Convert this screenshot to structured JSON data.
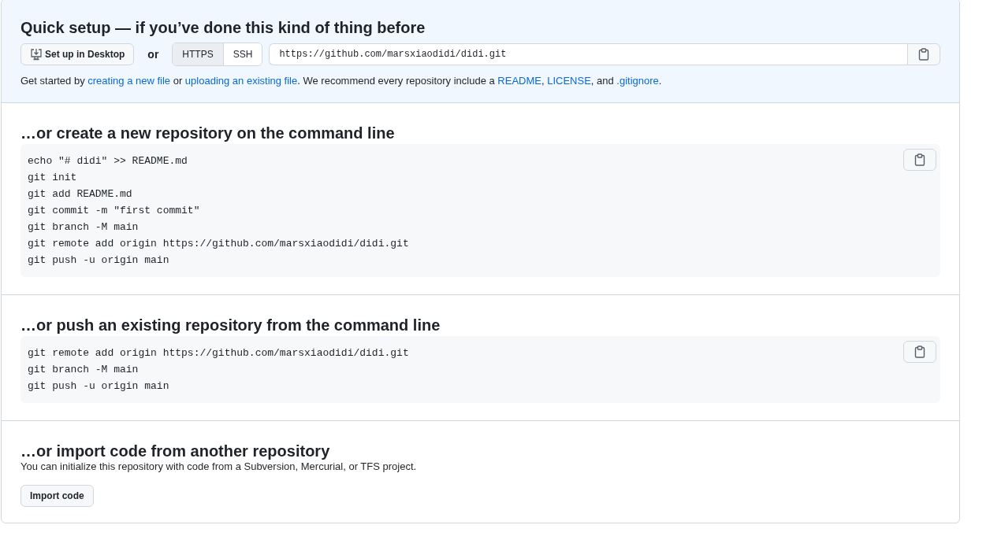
{
  "quick_setup": {
    "title": "Quick setup — if you’ve done this kind of thing before",
    "desktop_button": "Set up in Desktop",
    "or": "or",
    "protocols": [
      {
        "label": "HTTPS",
        "selected": true
      },
      {
        "label": "SSH",
        "selected": false
      }
    ],
    "url": "https://github.com/marsxiaodidi/didi.git",
    "intro": [
      {
        "text": "Get started by ",
        "link": false
      },
      {
        "text": "creating a new file",
        "link": true
      },
      {
        "text": " or ",
        "link": false
      },
      {
        "text": "uploading an existing file",
        "link": true
      },
      {
        "text": ". We recommend every repository include a ",
        "link": false
      },
      {
        "text": "README",
        "link": true
      },
      {
        "text": ", ",
        "link": false
      },
      {
        "text": "LICENSE",
        "link": true
      },
      {
        "text": ", and ",
        "link": false
      },
      {
        "text": ".gitignore",
        "link": true
      },
      {
        "text": ".",
        "link": false
      }
    ]
  },
  "sections": [
    {
      "kind": "code",
      "title": "…or create a new repository on the command line",
      "lines": [
        "echo \"# didi\" >> README.md",
        "git init",
        "git add README.md",
        "git commit -m \"first commit\"",
        "git branch -M main",
        "git remote add origin https://github.com/marsxiaodidi/didi.git",
        "git push -u origin main"
      ]
    },
    {
      "kind": "code",
      "title": "…or push an existing repository from the command line",
      "lines": [
        "git remote add origin https://github.com/marsxiaodidi/didi.git",
        "git branch -M main",
        "git push -u origin main"
      ]
    },
    {
      "kind": "import",
      "title": "…or import code from another repository",
      "description": "You can initialize this repository with code from a Subversion, Mercurial, or TFS project.",
      "button": "Import code"
    }
  ]
}
